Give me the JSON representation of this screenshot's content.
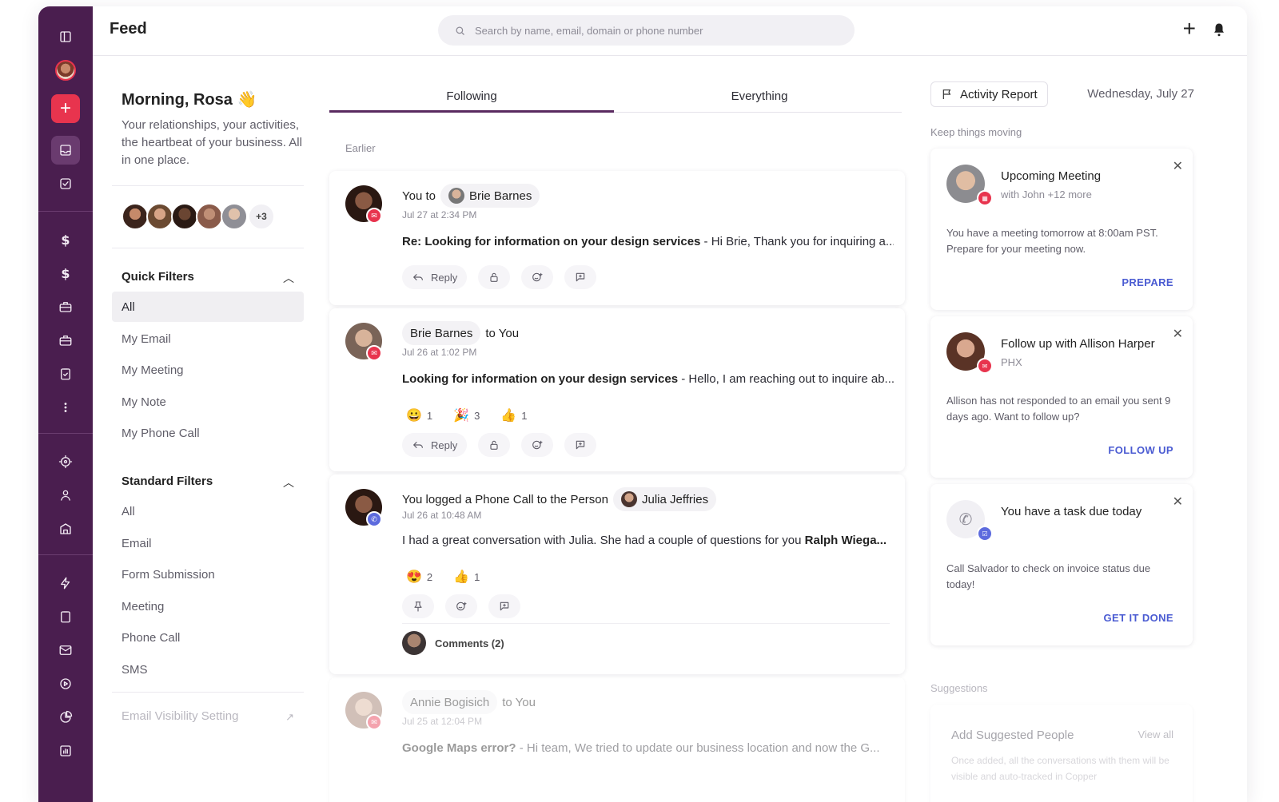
{
  "header": {
    "title": "Feed",
    "search_placeholder": "Search by name, email, domain or phone number"
  },
  "left": {
    "greeting": "Morning, Rosa 👋",
    "subtitle": "Your relationships, your activities, the heartbeat of your business. All in one place.",
    "more_count": "+3",
    "quick_filters": {
      "title": "Quick Filters",
      "items": [
        "All",
        "My Email",
        "My Meeting",
        "My Note",
        "My Phone Call"
      ]
    },
    "standard_filters": {
      "title": "Standard Filters",
      "items": [
        "All",
        "Email",
        "Form Submission",
        "Meeting",
        "Phone Call",
        "SMS"
      ]
    },
    "visibility_setting": "Email Visibility Setting"
  },
  "feed": {
    "tabs": [
      "Following",
      "Everything"
    ],
    "section_label": "Earlier",
    "cards": [
      {
        "prefix": "You to",
        "person": "Brie Barnes",
        "suffix": "",
        "time": "Jul 27 at 2:34 PM",
        "subject": "Re: Looking for information on your design services",
        "sep": " - ",
        "preview": "Hi Brie,  Thank you for inquiring a...",
        "reply_label": "Reply"
      },
      {
        "prefix": "",
        "person": "Brie Barnes",
        "suffix": "to You",
        "time": "Jul 26 at 1:02 PM",
        "subject": "Looking for information on your design services",
        "sep": " - ",
        "preview": "Hello, I am reaching out to inquire ab...",
        "reactions": [
          {
            "emoji": "😀",
            "count": "1"
          },
          {
            "emoji": "🎉",
            "count": "3"
          },
          {
            "emoji": "👍",
            "count": "1"
          }
        ],
        "reply_label": "Reply"
      },
      {
        "prefix": "You logged a Phone Call to the Person",
        "person": "Julia Jeffries",
        "suffix": "",
        "time": "Jul 26 at 10:48 AM",
        "body": "I had a great conversation with Julia. She had a couple of questions for you ",
        "body_bold": "Ralph Wiega...",
        "reactions": [
          {
            "emoji": "😍",
            "count": "2"
          },
          {
            "emoji": "👍",
            "count": "1"
          }
        ],
        "comments_label": "Comments (2)"
      },
      {
        "prefix": "",
        "person": "Annie Bogisich",
        "suffix": "to You",
        "time": "Jul 25 at 12:04 PM",
        "subject": "Google Maps error?",
        "sep": " - ",
        "preview": "Hi team, We tried to update our business location and now the G..."
      }
    ]
  },
  "right": {
    "activity_report": "Activity Report",
    "date": "Wednesday, July 27",
    "keep_label": "Keep things moving",
    "cards": [
      {
        "title": "Upcoming Meeting",
        "sub": "with John +12 more",
        "body": "You have a meeting tomorrow at 8:00am PST. Prepare for your meeting now.",
        "cta": "PREPARE"
      },
      {
        "title": "Follow up with Allison Harper",
        "sub": "PHX",
        "body": "Allison has not responded to an email you sent 9 days ago. Want to follow up?",
        "cta": "FOLLOW UP"
      },
      {
        "title": "You have a task due today",
        "sub": "",
        "body": "Call Salvador to check on invoice status due today!",
        "cta": "GET IT DONE"
      }
    ],
    "suggestions_label": "Suggestions",
    "suggest_card": {
      "title": "Add Suggested People",
      "view_all": "View all",
      "body": "Once added, all the conversations with them will be visible and auto-tracked in Copper"
    }
  },
  "colors": {
    "rail": "#4a1e4f",
    "accent_red": "#e8344e",
    "link_blue": "#4a5bd2",
    "tab_underline": "#5a2a60"
  }
}
